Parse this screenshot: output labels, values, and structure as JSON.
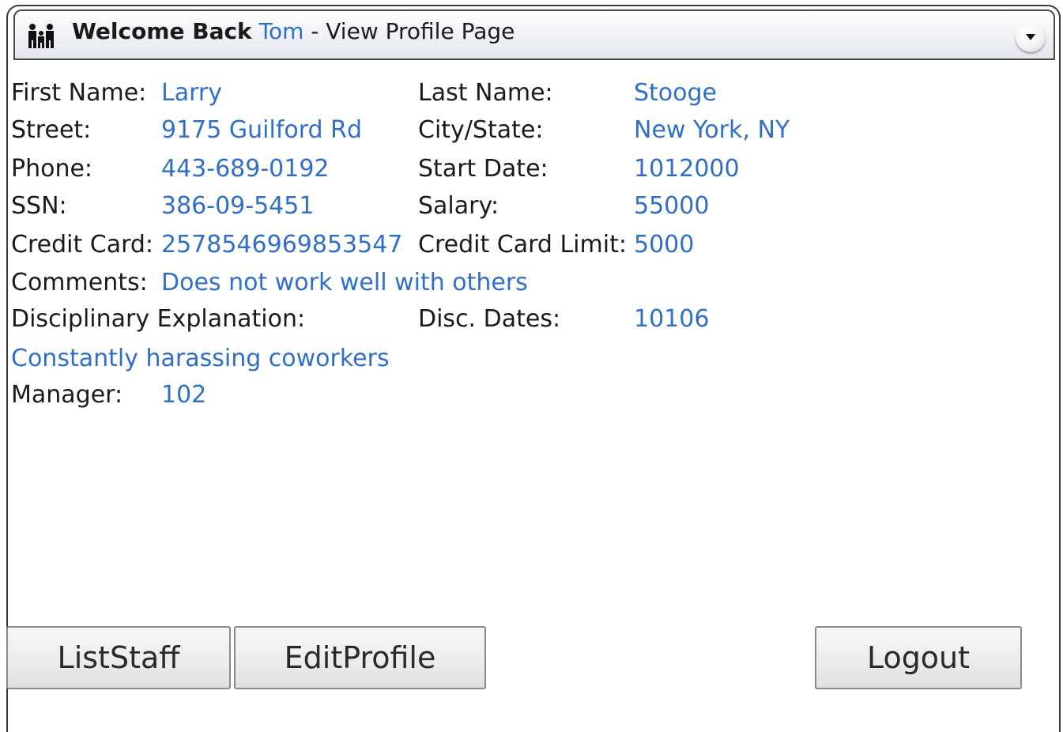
{
  "header": {
    "welcome_text": "Welcome Back",
    "user_name": "Tom",
    "title_suffix": "- View Profile Page",
    "icon": "people-icon",
    "dropdown_icon": "chevron-down-icon"
  },
  "profile": {
    "first_name_label": "First Name:",
    "first_name": "Larry",
    "last_name_label": "Last Name:",
    "last_name": "Stooge",
    "street_label": "Street:",
    "street": "9175 Guilford Rd",
    "city_state_label": "City/State:",
    "city_state": "New York, NY",
    "phone_label": "Phone:",
    "phone": "443-689-0192",
    "start_date_label": "Start Date:",
    "start_date": "1012000",
    "ssn_label": "SSN:",
    "ssn": "386-09-5451",
    "salary_label": "Salary:",
    "salary": "55000",
    "credit_card_label": "Credit Card:",
    "credit_card": "2578546969853547",
    "credit_limit_label": "Credit Card Limit:",
    "credit_limit": "5000",
    "comments_label": "Comments:",
    "comments": "Does not work well with others",
    "disciplinary_label": "Disciplinary Explanation:",
    "disc_dates_label": "Disc. Dates:",
    "disc_dates": "10106",
    "disciplinary_explanation": "Constantly harassing coworkers",
    "manager_label": "Manager:",
    "manager": "102"
  },
  "buttons": {
    "list_staff": "ListStaff",
    "edit_profile": "EditProfile",
    "logout": "Logout"
  },
  "colors": {
    "value_text": "#2f6fc9",
    "label_text": "#1a1a1a"
  }
}
